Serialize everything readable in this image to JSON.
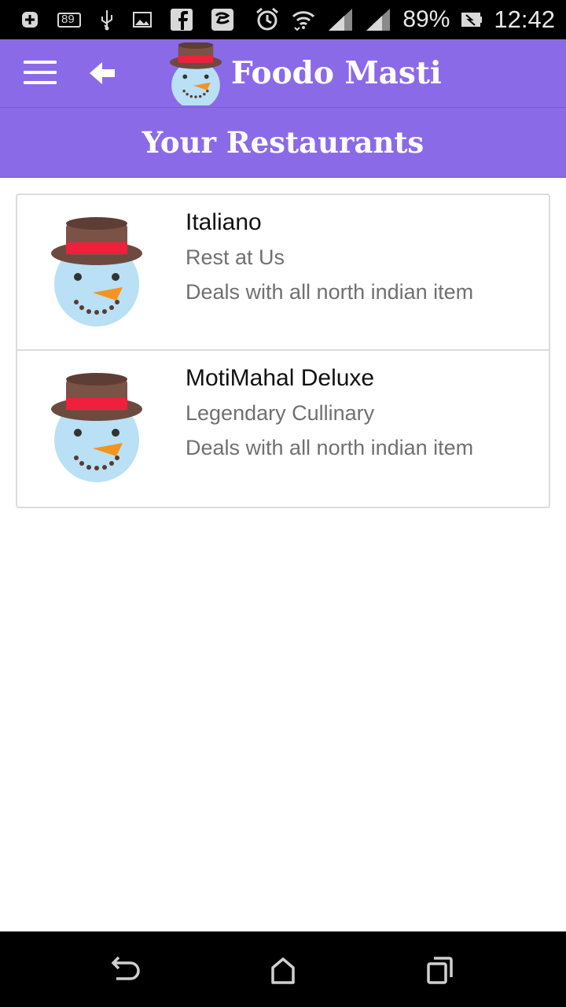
{
  "status_bar": {
    "notification_badge": "89",
    "battery_percent": "89%",
    "time": "12:42",
    "icons": [
      "add-box-icon",
      "notification-count-icon",
      "usb-icon",
      "image-icon",
      "facebook-icon",
      "app-icon",
      "alarm-icon",
      "wifi-icon",
      "signal-icon",
      "signal-icon",
      "battery-icon"
    ]
  },
  "app_bar": {
    "title": "Foodo Masti",
    "color": "#8b6ae8"
  },
  "page": {
    "title": "Your Restaurants"
  },
  "restaurants": [
    {
      "name": "Italiano",
      "tagline": "Rest at Us",
      "description": "Deals with all north indian item"
    },
    {
      "name": "MotiMahal Deluxe",
      "tagline": "Legendary Cullinary",
      "description": "Deals with all north indian item"
    }
  ]
}
